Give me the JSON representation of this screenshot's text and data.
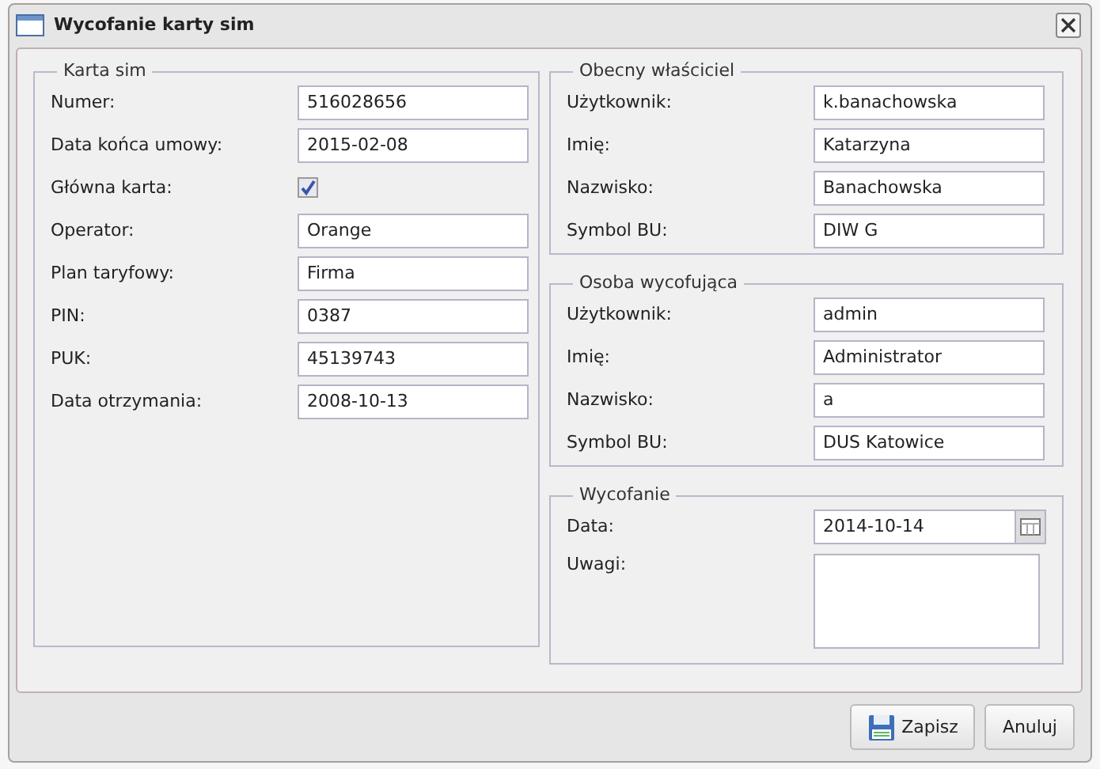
{
  "window": {
    "title": "Wycofanie karty sim"
  },
  "left_section": {
    "title": "Karta sim",
    "fields": [
      {
        "label": "Numer:",
        "kind": "text",
        "value": "516028656"
      },
      {
        "label": "Data końca umowy:",
        "kind": "text",
        "value": "2015-02-08"
      },
      {
        "label": "Główna karta:",
        "kind": "checkbox",
        "checked": true
      },
      {
        "label": "Operator:",
        "kind": "text",
        "value": "Orange"
      },
      {
        "label": "Plan taryfowy:",
        "kind": "text",
        "value": "Firma"
      },
      {
        "label": "PIN:",
        "kind": "text",
        "value": "0387"
      },
      {
        "label": "PUK:",
        "kind": "text",
        "value": "45139743"
      },
      {
        "label": "Data otrzymania:",
        "kind": "text",
        "value": "2008-10-13"
      }
    ]
  },
  "right_sections": [
    {
      "title": "Obecny właściciel",
      "fields": [
        {
          "label": "Użytkownik:",
          "kind": "text",
          "value": "k.banachowska"
        },
        {
          "label": "Imię:",
          "kind": "text",
          "value": "Katarzyna"
        },
        {
          "label": "Nazwisko:",
          "kind": "text",
          "value": "Banachowska"
        },
        {
          "label": "Symbol BU:",
          "kind": "text",
          "value": "DIW G"
        }
      ]
    },
    {
      "title": "Osoba wycofująca",
      "fields": [
        {
          "label": "Użytkownik:",
          "kind": "text",
          "value": "admin"
        },
        {
          "label": "Imię:",
          "kind": "text",
          "value": "Administrator"
        },
        {
          "label": "Nazwisko:",
          "kind": "text",
          "value": "a"
        },
        {
          "label": "Symbol BU:",
          "kind": "text",
          "value": "DUS Katowice"
        }
      ]
    },
    {
      "title": "Wycofanie",
      "fields": [
        {
          "label": "Data:",
          "kind": "date",
          "value": "2014-10-14"
        },
        {
          "label": "Uwagi:",
          "kind": "textarea"
        }
      ]
    }
  ],
  "buttons": [
    {
      "label": "Zapisz",
      "kind": "save"
    },
    {
      "label": "Anuluj",
      "kind": "plain"
    }
  ]
}
